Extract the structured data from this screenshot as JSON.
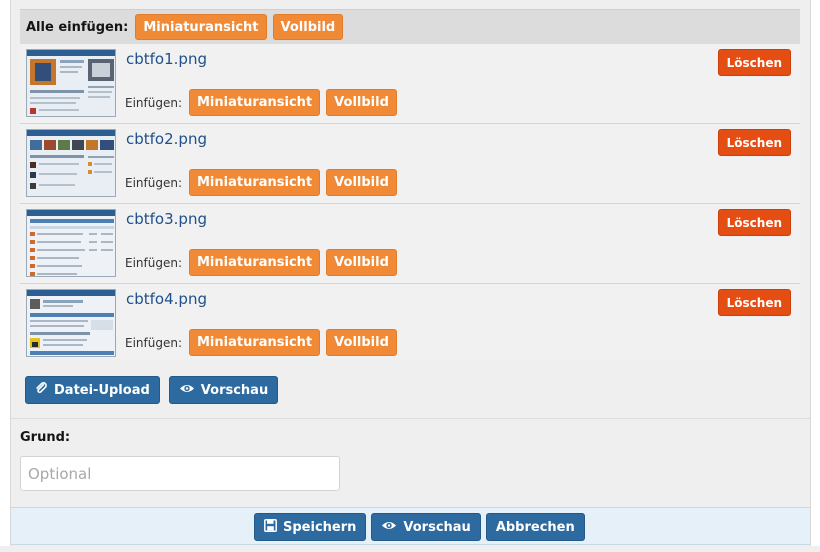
{
  "insert_all": {
    "label": "Alle einfügen:",
    "thumbnail_label": "Miniaturansicht",
    "full_label": "Vollbild"
  },
  "attachments": [
    {
      "filename": "cbtfo1.png",
      "insert_label": "Einfügen:",
      "thumbnail_label": "Miniaturansicht",
      "full_label": "Vollbild",
      "delete_label": "Löschen"
    },
    {
      "filename": "cbtfo2.png",
      "insert_label": "Einfügen:",
      "thumbnail_label": "Miniaturansicht",
      "full_label": "Vollbild",
      "delete_label": "Löschen"
    },
    {
      "filename": "cbtfo3.png",
      "insert_label": "Einfügen:",
      "thumbnail_label": "Miniaturansicht",
      "full_label": "Vollbild",
      "delete_label": "Löschen"
    },
    {
      "filename": "cbtfo4.png",
      "insert_label": "Einfügen:",
      "thumbnail_label": "Miniaturansicht",
      "full_label": "Vollbild",
      "delete_label": "Löschen"
    }
  ],
  "upload": {
    "upload_label": "Datei-Upload",
    "upload_icon": "paperclip-icon",
    "preview_label": "Vorschau",
    "preview_icon": "eye-icon"
  },
  "reason": {
    "label": "Grund:",
    "placeholder": "Optional",
    "value": ""
  },
  "actions": {
    "save_label": "Speichern",
    "save_icon": "floppy-disk-icon",
    "preview_label": "Vorschau",
    "preview_icon": "eye-icon",
    "cancel_label": "Abbrechen"
  },
  "colors": {
    "insert_button": "#f08a37",
    "delete_button": "#e44e12",
    "primary_button": "#2c6aa0",
    "filename_link": "#1f4f8a"
  }
}
